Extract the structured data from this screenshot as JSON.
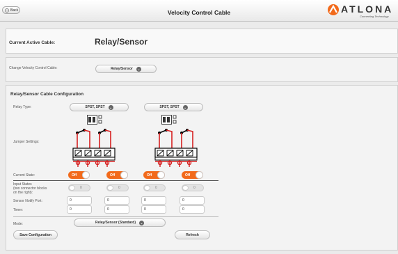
{
  "header": {
    "back_label": "Back",
    "title": "Velocity Control Cable",
    "logo_text": "ATLONA",
    "logo_tagline": "Connecting Technology"
  },
  "active_cable": {
    "label": "Current Active Cable:",
    "value": "Relay/Sensor"
  },
  "change_cable": {
    "label": "Change Velocity Control Cable:",
    "selected": "Relay/Sensor"
  },
  "config": {
    "title": "Relay/Sensor Cable Configuration",
    "relay_type_label": "Relay Type:",
    "relay_types": [
      "SPST, SPST",
      "SPST, SPST"
    ],
    "jumper_label": "Jumper Settings:",
    "current_state_label": "Current State:",
    "current_states": [
      "Off",
      "Off",
      "Off",
      "Off"
    ],
    "input_states_label": [
      "Input States",
      "(two connector blocks",
      "on the right):"
    ],
    "input_states": [
      "0",
      "0",
      "0",
      "0"
    ],
    "sensor_notify_label": "Sensor Notify Port:",
    "sensor_notify_ports": [
      "0",
      "0",
      "0",
      "0"
    ],
    "timer_label": "Timer:",
    "timers": [
      "0",
      "0",
      "0",
      "0"
    ],
    "mode_label": "Mode:",
    "mode_selected": "Relay/Sensor (Standard)",
    "save_label": "Save Configuration",
    "refresh_label": "Refresh"
  },
  "colors": {
    "accent": "#f26a1b",
    "logo": "#f26a1b",
    "wire": "#d62020"
  },
  "icons": [
    "back-arrow-icon",
    "chevron-down-icon",
    "atlona-logo-icon",
    "jumper-icon",
    "relay-diagram-icon"
  ]
}
